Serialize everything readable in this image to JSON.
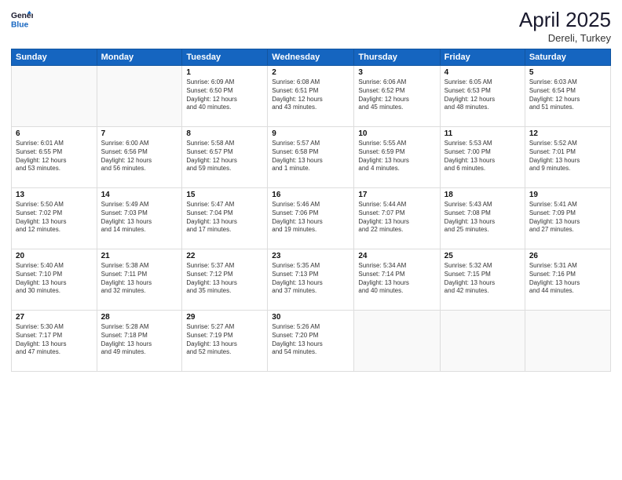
{
  "header": {
    "logo_line1": "General",
    "logo_line2": "Blue",
    "month_year": "April 2025",
    "location": "Dereli, Turkey"
  },
  "days_of_week": [
    "Sunday",
    "Monday",
    "Tuesday",
    "Wednesday",
    "Thursday",
    "Friday",
    "Saturday"
  ],
  "weeks": [
    [
      {
        "day": "",
        "info": ""
      },
      {
        "day": "",
        "info": ""
      },
      {
        "day": "1",
        "info": "Sunrise: 6:09 AM\nSunset: 6:50 PM\nDaylight: 12 hours\nand 40 minutes."
      },
      {
        "day": "2",
        "info": "Sunrise: 6:08 AM\nSunset: 6:51 PM\nDaylight: 12 hours\nand 43 minutes."
      },
      {
        "day": "3",
        "info": "Sunrise: 6:06 AM\nSunset: 6:52 PM\nDaylight: 12 hours\nand 45 minutes."
      },
      {
        "day": "4",
        "info": "Sunrise: 6:05 AM\nSunset: 6:53 PM\nDaylight: 12 hours\nand 48 minutes."
      },
      {
        "day": "5",
        "info": "Sunrise: 6:03 AM\nSunset: 6:54 PM\nDaylight: 12 hours\nand 51 minutes."
      }
    ],
    [
      {
        "day": "6",
        "info": "Sunrise: 6:01 AM\nSunset: 6:55 PM\nDaylight: 12 hours\nand 53 minutes."
      },
      {
        "day": "7",
        "info": "Sunrise: 6:00 AM\nSunset: 6:56 PM\nDaylight: 12 hours\nand 56 minutes."
      },
      {
        "day": "8",
        "info": "Sunrise: 5:58 AM\nSunset: 6:57 PM\nDaylight: 12 hours\nand 59 minutes."
      },
      {
        "day": "9",
        "info": "Sunrise: 5:57 AM\nSunset: 6:58 PM\nDaylight: 13 hours\nand 1 minute."
      },
      {
        "day": "10",
        "info": "Sunrise: 5:55 AM\nSunset: 6:59 PM\nDaylight: 13 hours\nand 4 minutes."
      },
      {
        "day": "11",
        "info": "Sunrise: 5:53 AM\nSunset: 7:00 PM\nDaylight: 13 hours\nand 6 minutes."
      },
      {
        "day": "12",
        "info": "Sunrise: 5:52 AM\nSunset: 7:01 PM\nDaylight: 13 hours\nand 9 minutes."
      }
    ],
    [
      {
        "day": "13",
        "info": "Sunrise: 5:50 AM\nSunset: 7:02 PM\nDaylight: 13 hours\nand 12 minutes."
      },
      {
        "day": "14",
        "info": "Sunrise: 5:49 AM\nSunset: 7:03 PM\nDaylight: 13 hours\nand 14 minutes."
      },
      {
        "day": "15",
        "info": "Sunrise: 5:47 AM\nSunset: 7:04 PM\nDaylight: 13 hours\nand 17 minutes."
      },
      {
        "day": "16",
        "info": "Sunrise: 5:46 AM\nSunset: 7:06 PM\nDaylight: 13 hours\nand 19 minutes."
      },
      {
        "day": "17",
        "info": "Sunrise: 5:44 AM\nSunset: 7:07 PM\nDaylight: 13 hours\nand 22 minutes."
      },
      {
        "day": "18",
        "info": "Sunrise: 5:43 AM\nSunset: 7:08 PM\nDaylight: 13 hours\nand 25 minutes."
      },
      {
        "day": "19",
        "info": "Sunrise: 5:41 AM\nSunset: 7:09 PM\nDaylight: 13 hours\nand 27 minutes."
      }
    ],
    [
      {
        "day": "20",
        "info": "Sunrise: 5:40 AM\nSunset: 7:10 PM\nDaylight: 13 hours\nand 30 minutes."
      },
      {
        "day": "21",
        "info": "Sunrise: 5:38 AM\nSunset: 7:11 PM\nDaylight: 13 hours\nand 32 minutes."
      },
      {
        "day": "22",
        "info": "Sunrise: 5:37 AM\nSunset: 7:12 PM\nDaylight: 13 hours\nand 35 minutes."
      },
      {
        "day": "23",
        "info": "Sunrise: 5:35 AM\nSunset: 7:13 PM\nDaylight: 13 hours\nand 37 minutes."
      },
      {
        "day": "24",
        "info": "Sunrise: 5:34 AM\nSunset: 7:14 PM\nDaylight: 13 hours\nand 40 minutes."
      },
      {
        "day": "25",
        "info": "Sunrise: 5:32 AM\nSunset: 7:15 PM\nDaylight: 13 hours\nand 42 minutes."
      },
      {
        "day": "26",
        "info": "Sunrise: 5:31 AM\nSunset: 7:16 PM\nDaylight: 13 hours\nand 44 minutes."
      }
    ],
    [
      {
        "day": "27",
        "info": "Sunrise: 5:30 AM\nSunset: 7:17 PM\nDaylight: 13 hours\nand 47 minutes."
      },
      {
        "day": "28",
        "info": "Sunrise: 5:28 AM\nSunset: 7:18 PM\nDaylight: 13 hours\nand 49 minutes."
      },
      {
        "day": "29",
        "info": "Sunrise: 5:27 AM\nSunset: 7:19 PM\nDaylight: 13 hours\nand 52 minutes."
      },
      {
        "day": "30",
        "info": "Sunrise: 5:26 AM\nSunset: 7:20 PM\nDaylight: 13 hours\nand 54 minutes."
      },
      {
        "day": "",
        "info": ""
      },
      {
        "day": "",
        "info": ""
      },
      {
        "day": "",
        "info": ""
      }
    ]
  ]
}
